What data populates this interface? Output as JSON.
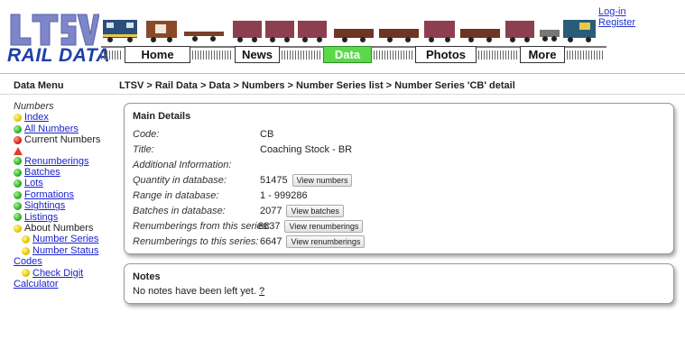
{
  "header": {
    "logo_text": "RAIL DATA",
    "logo_mark": "LTSV",
    "nav": [
      {
        "label": "Home",
        "active": false
      },
      {
        "label": "News",
        "active": false
      },
      {
        "label": "Data",
        "active": true
      },
      {
        "label": "Photos",
        "active": false
      },
      {
        "label": "More",
        "active": false
      }
    ],
    "login": "Log-in",
    "register": "Register"
  },
  "sidebar": {
    "title": "Data Menu",
    "section": "Numbers",
    "items": [
      {
        "label": "Index",
        "icon": "yellow-dot-icon",
        "link": true
      },
      {
        "label": "All Numbers",
        "icon": "green-dot-icon",
        "link": true
      },
      {
        "label": "Current Numbers",
        "icon": "red-dot-icon",
        "link": false
      },
      {
        "label": "",
        "icon": "warning-icon",
        "link": false
      },
      {
        "label": "Renumberings",
        "icon": "green-dot-icon",
        "link": true
      },
      {
        "label": "Batches",
        "icon": "green-dot-icon",
        "link": true
      },
      {
        "label": "Lots",
        "icon": "green-dot-icon",
        "link": true
      },
      {
        "label": "Formations",
        "icon": "green-dot-icon",
        "link": true
      },
      {
        "label": "Sightings",
        "icon": "green-dot-icon",
        "link": true
      },
      {
        "label": "Listings",
        "icon": "green-dot-icon",
        "link": true
      },
      {
        "label": "About Numbers",
        "icon": "yellow-dot-icon",
        "link": false
      },
      {
        "label": "Number Series",
        "icon": "yellow-dot-icon",
        "link": true,
        "indent": true
      },
      {
        "label": "Number Status",
        "icon": "yellow-dot-icon",
        "link": true,
        "indent": true
      },
      {
        "label": "Codes",
        "icon": "",
        "link": true
      },
      {
        "label": "Check Digit",
        "icon": "yellow-dot-icon",
        "link": true,
        "indent": true
      },
      {
        "label": "Calculator",
        "icon": "",
        "link": true
      }
    ]
  },
  "breadcrumb": "LTSV > Rail Data > Data > Numbers > Number Series list > Number Series 'CB' detail",
  "main_details": {
    "title": "Main Details",
    "rows": [
      {
        "label": "Code:",
        "value": "CB",
        "button": ""
      },
      {
        "label": "Title:",
        "value": "Coaching Stock - BR",
        "button": ""
      },
      {
        "label": "Additional Information:",
        "value": "",
        "button": ""
      },
      {
        "label": "Quantity in database:",
        "value": "51475",
        "button": "View numbers"
      },
      {
        "label": "Range in database:",
        "value": "1 - 999286",
        "button": ""
      },
      {
        "label": "Batches in database:",
        "value": "2077",
        "button": "View batches"
      },
      {
        "label": "Renumberings from this series:",
        "value": "8837",
        "button": "View renumberings"
      },
      {
        "label": "Renumberings to this series:",
        "value": "6647",
        "button": "View renumberings"
      }
    ]
  },
  "notes": {
    "title": "Notes",
    "text": "No notes have been left yet.",
    "help_link": "?"
  },
  "colors": {
    "active_nav": "#5cd94a",
    "logo_blue": "#1f3fa8",
    "link": "#1a22cc"
  }
}
